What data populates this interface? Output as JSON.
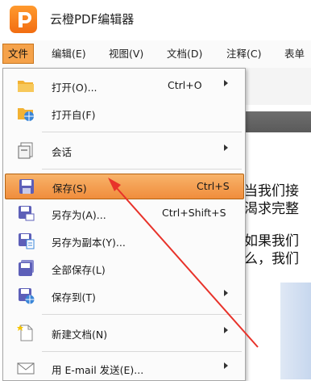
{
  "app": {
    "title": "云橙PDF编辑器"
  },
  "menubar": [
    {
      "label": "文件",
      "active": true
    },
    {
      "label": "编辑(E)"
    },
    {
      "label": "视图(V)"
    },
    {
      "label": "文档(D)"
    },
    {
      "label": "注释(C)"
    },
    {
      "label": "表单"
    }
  ],
  "file_menu": [
    {
      "label": "打开(O)...",
      "shortcut": "Ctrl+O",
      "submenu": true,
      "icon": "folder-icon"
    },
    {
      "label": "打开自(F)",
      "submenu": false,
      "icon": "folder-web-icon"
    },
    {
      "label": "会话",
      "submenu": true,
      "icon": "session-icon"
    },
    {
      "label": "保存(S)",
      "shortcut": "Ctrl+S",
      "highlighted": true,
      "icon": "save-icon"
    },
    {
      "label": "另存为(A)...",
      "shortcut": "Ctrl+Shift+S",
      "icon": "save-as-icon"
    },
    {
      "label": "另存为副本(Y)...",
      "icon": "save-copy-icon"
    },
    {
      "label": "全部保存(L)",
      "icon": "save-all-icon"
    },
    {
      "label": "保存到(T)",
      "submenu": true,
      "icon": "save-to-icon"
    },
    {
      "label": "新建文档(N)",
      "submenu": true,
      "icon": "new-document-icon"
    },
    {
      "label": "用 E-mail 发送(E)...",
      "submenu": true,
      "icon": "email-icon"
    }
  ],
  "document_text": [
    "当我们接",
    "渴求完整",
    "如果我们",
    "么，我们"
  ],
  "colors": {
    "accent": "#f08d3c",
    "logo": "#f26d12",
    "annotation_arrow": "#e8322a"
  }
}
